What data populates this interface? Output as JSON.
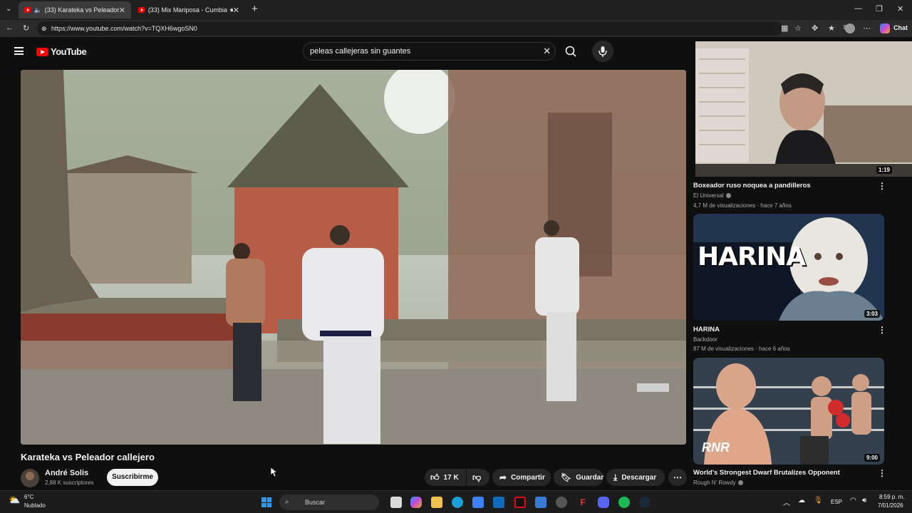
{
  "tabs": [
    {
      "label": "(33) Karateka vs Peleador calle",
      "active": true
    },
    {
      "label": "(33) Mix Mariposa - Cumbia ★ DJ",
      "active": false
    }
  ],
  "address_bar": {
    "url": "https://www.youtube.com/watch?v=TQXH6wgoSN0",
    "chat_label": "Chat"
  },
  "youtube": {
    "logo_text": "YouTube",
    "search_value": "peleas callejeras sin guantes"
  },
  "video": {
    "title": "Karateka vs Peleador callejero",
    "channel": "André Solis",
    "subscribers": "2,88 K suscriptores",
    "subscribe_label": "Suscribirme",
    "likes": "17 K",
    "share_label": "Compartir",
    "save_label": "Guardar",
    "download_label": "Descargar"
  },
  "related": [
    {
      "title": "Boxeador ruso noquea a pandilleros",
      "channel": "El Universal",
      "meta": "4,7 M de visualizaciones · hace 7 años",
      "duration": "1:19",
      "verified": true
    },
    {
      "title": "HARINA",
      "channel": "Backdoor",
      "meta": "87 M de visualizaciones · hace 6 años",
      "duration": "3:03",
      "verified": true,
      "thumb_text": "HARINA"
    },
    {
      "title": "World's Strongest Dwarf Brutalizes Opponent",
      "channel": "Rough N' Rowdy",
      "meta": "",
      "duration": "9:00",
      "verified": true,
      "thumb_text": "RNR"
    }
  ],
  "taskbar": {
    "weather_temp": "6°C",
    "weather_desc": "Nublado",
    "search_label": "Buscar",
    "lang": "ESP",
    "time": "8:59 p. m.",
    "date": "7/01/2026"
  },
  "colors": {
    "brand_red": "#ff0000",
    "bg": "#0f0f0f",
    "pill": "#272727"
  }
}
